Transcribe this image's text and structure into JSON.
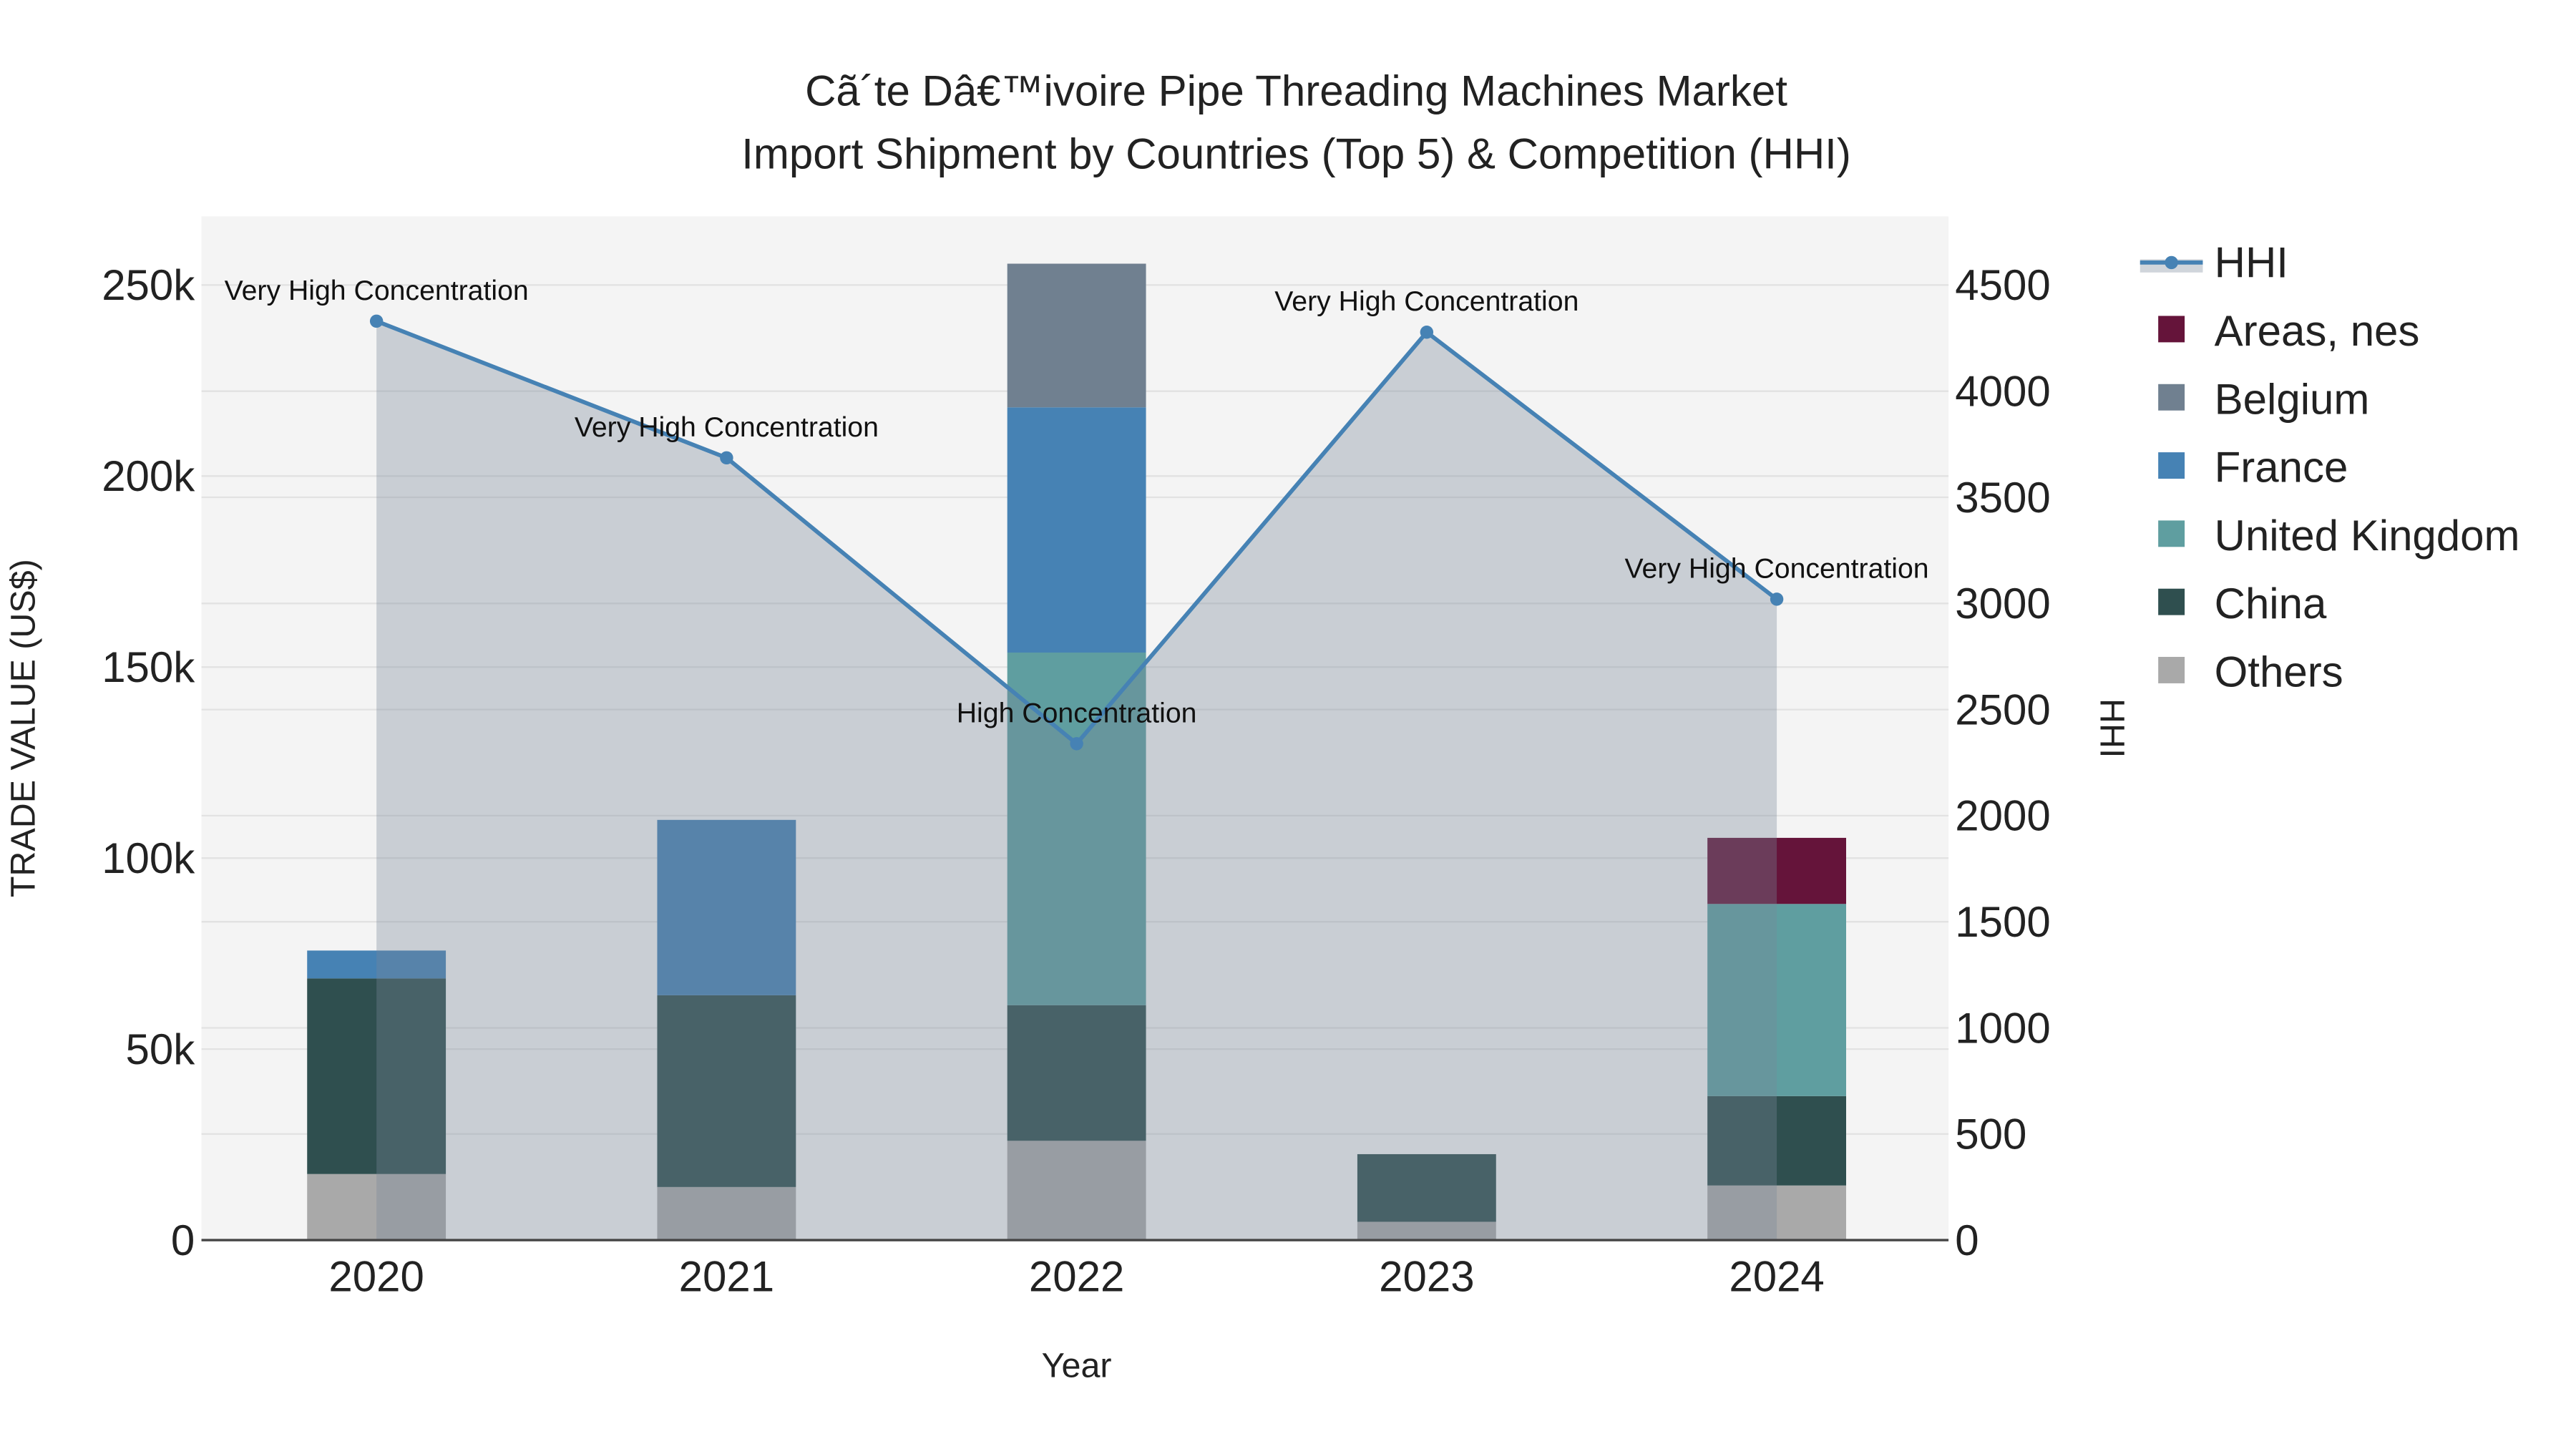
{
  "chart_data": {
    "type": "bar",
    "title_line1": "Cã´te Dâ€™ivoire Pipe Threading Machines Market",
    "title_line2": "Import Shipment by Countries (Top 5) & Competition (HHI)",
    "xlabel": "Year",
    "ylabel": "TRADE VALUE (US$)",
    "y2label": "HHI",
    "categories": [
      "2020",
      "2021",
      "2022",
      "2023",
      "2024"
    ],
    "ylim": [
      0,
      268000
    ],
    "y2lim": [
      0,
      4824
    ],
    "yticks": [
      0,
      50000,
      100000,
      150000,
      200000,
      250000
    ],
    "ytick_labels": [
      "0",
      "50k",
      "100k",
      "150k",
      "200k",
      "250k"
    ],
    "y2ticks": [
      0,
      500,
      1000,
      1500,
      2000,
      2500,
      3000,
      3500,
      4000,
      4500
    ],
    "y2tick_labels": [
      "0",
      "500",
      "1000",
      "1500",
      "2000",
      "2500",
      "3000",
      "3500",
      "4000",
      "4500"
    ],
    "series": [
      {
        "name": "Others",
        "color": "#a9a9a9",
        "values": [
          17300,
          13900,
          26000,
          4800,
          14300
        ]
      },
      {
        "name": "China",
        "color": "#2f4f4f",
        "values": [
          51200,
          50200,
          35500,
          17700,
          23400
        ]
      },
      {
        "name": "United Kingdom",
        "color": "#5f9ea0",
        "values": [
          0,
          0,
          92300,
          0,
          50300
        ]
      },
      {
        "name": "France",
        "color": "#4682b4",
        "values": [
          7300,
          45900,
          64200,
          0,
          0
        ]
      },
      {
        "name": "Belgium",
        "color": "#708090",
        "values": [
          0,
          0,
          37600,
          0,
          0
        ]
      },
      {
        "name": "Areas, nes",
        "color": "#65143a",
        "values": [
          0,
          0,
          0,
          0,
          17300
        ]
      }
    ],
    "hhi": {
      "name": "HHI",
      "color": "#4682b4",
      "values": [
        4330,
        3686,
        2339,
        4278,
        3020
      ],
      "annotations": [
        "Very High Concentration",
        "Very High Concentration",
        "High Concentration",
        "Very High Concentration",
        "Very High Concentration"
      ]
    },
    "legend_order": [
      "HHI",
      "Areas, nes",
      "Belgium",
      "France",
      "United Kingdom",
      "China",
      "Others"
    ],
    "legend_position": "right",
    "grid": true
  }
}
